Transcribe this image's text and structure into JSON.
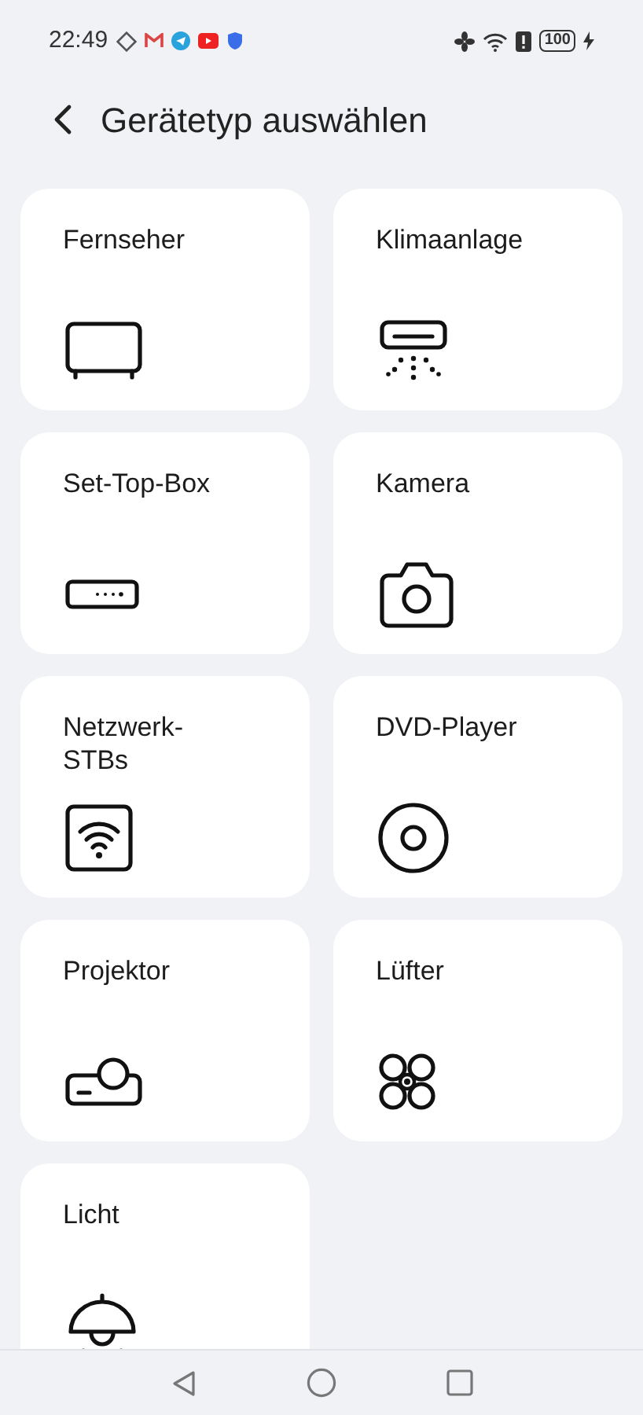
{
  "status_bar": {
    "time": "22:49",
    "battery": "100"
  },
  "header": {
    "title": "Gerätetyp auswählen"
  },
  "devices": [
    {
      "label": "Fernseher",
      "kind": "tv"
    },
    {
      "label": "Klimaanlage",
      "kind": "ac"
    },
    {
      "label": "Set-Top-Box",
      "kind": "stb"
    },
    {
      "label": "Kamera",
      "kind": "camera"
    },
    {
      "label": "Netzwerk-STBs",
      "kind": "network"
    },
    {
      "label": "DVD-Player",
      "kind": "disc"
    },
    {
      "label": "Projektor",
      "kind": "projector"
    },
    {
      "label": "Lüfter",
      "kind": "fan"
    },
    {
      "label": "Licht",
      "kind": "lamp"
    }
  ]
}
